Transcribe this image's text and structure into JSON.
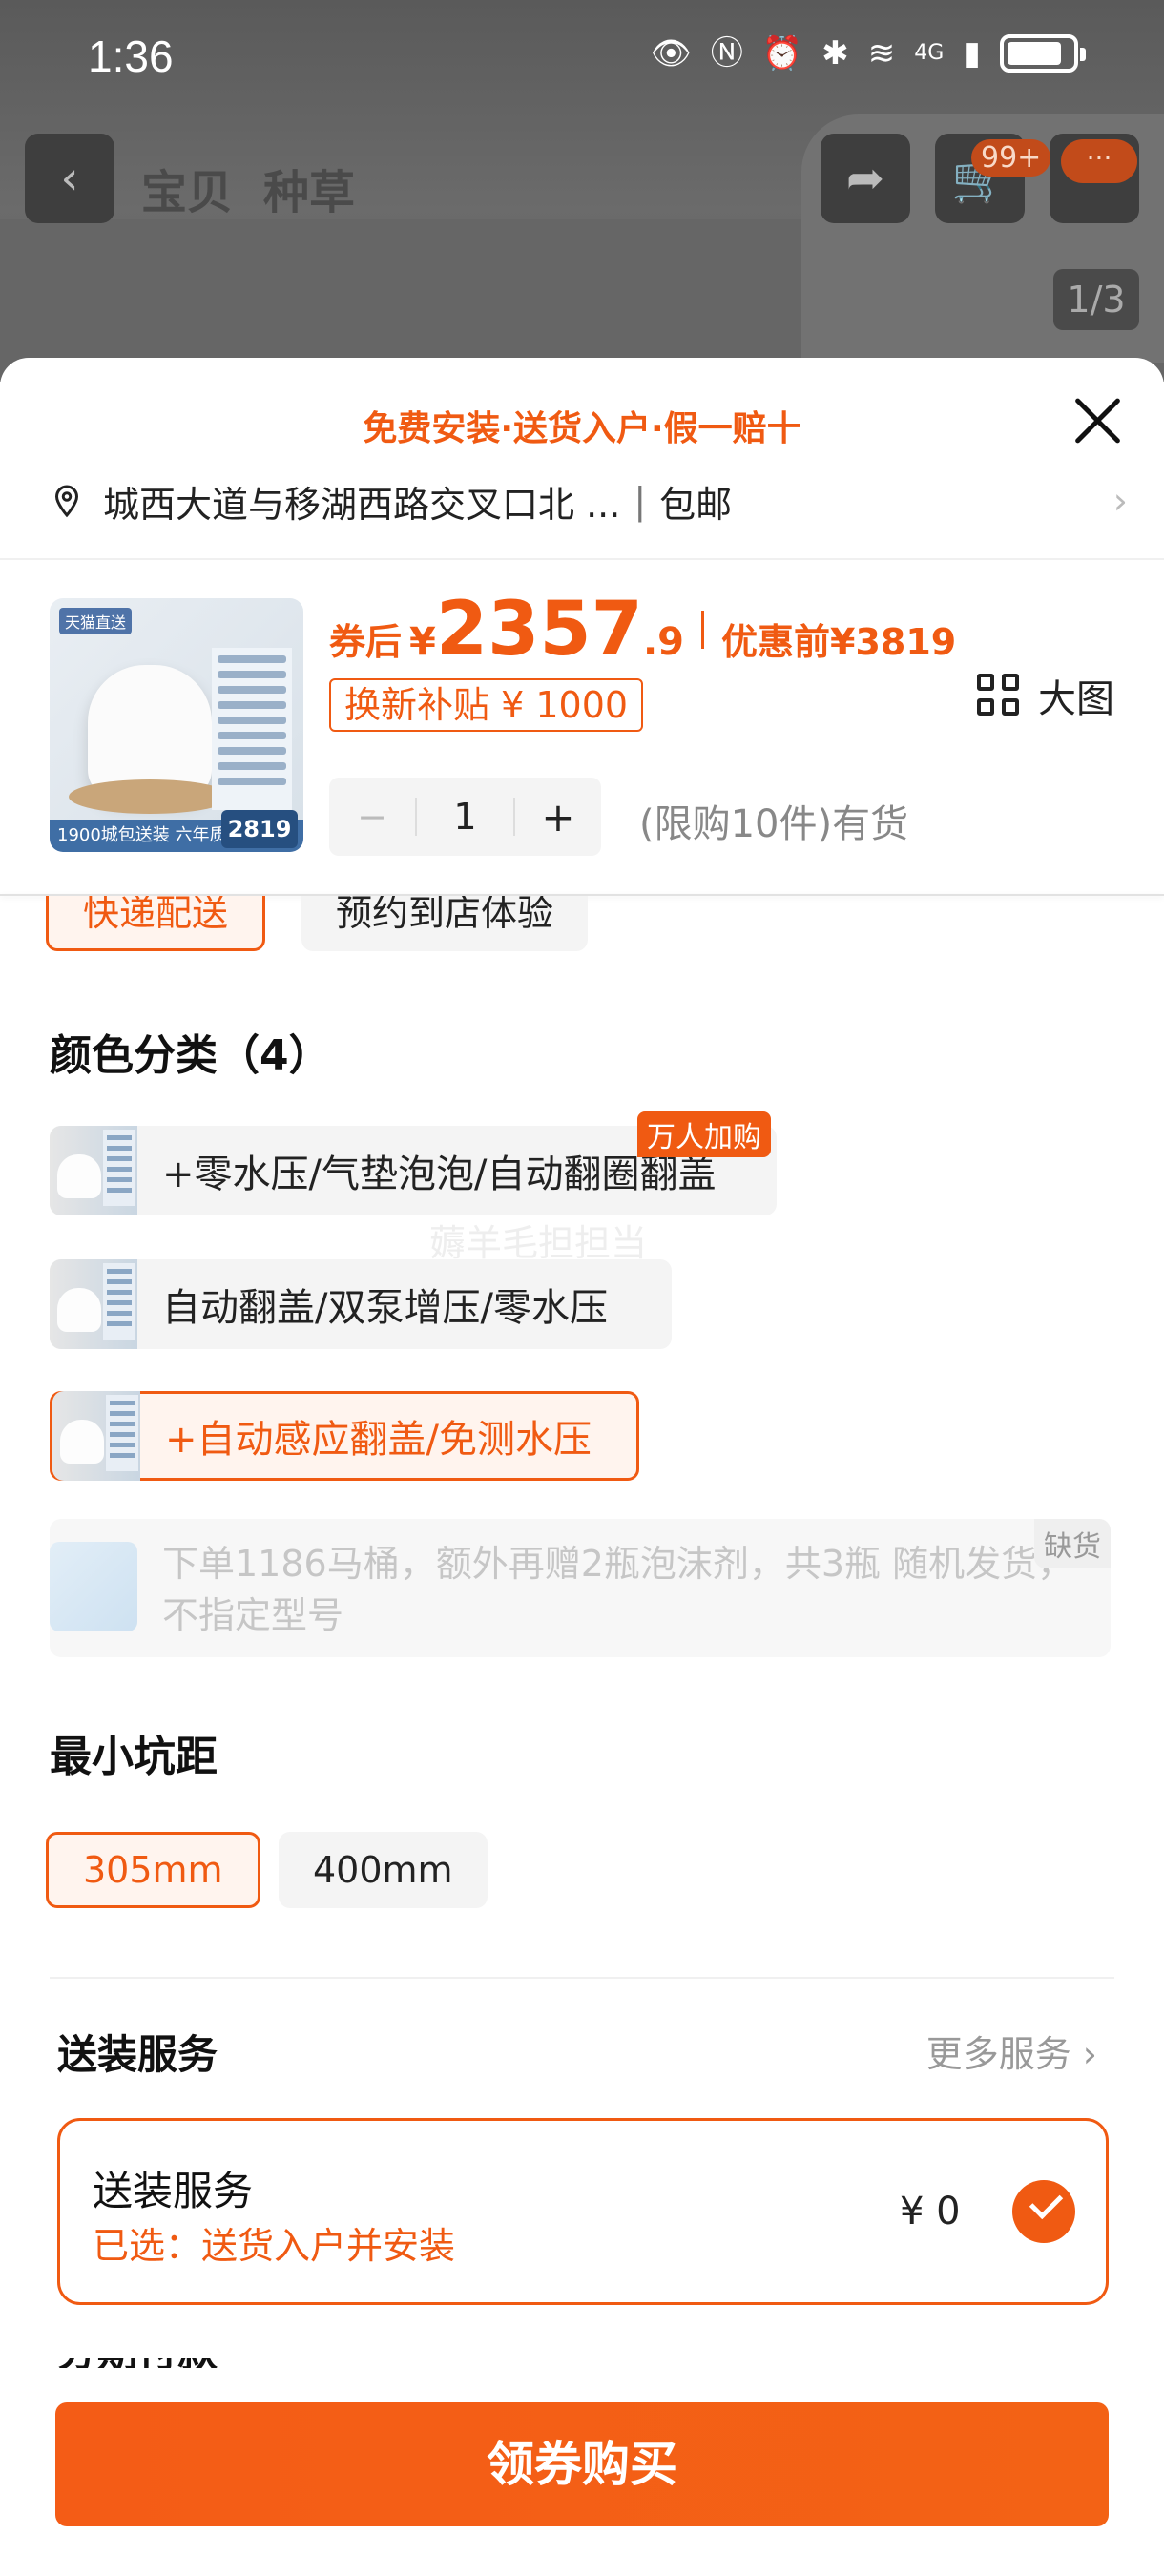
{
  "status": {
    "time": "1:36",
    "network": "4G",
    "icons": [
      "eye-icon",
      "nfc-icon",
      "alarm-icon",
      "bluetooth-icon",
      "wifi-icon",
      "signal-icon",
      "battery-icon"
    ]
  },
  "nav": {
    "tabs": [
      "宝贝",
      "种草"
    ],
    "cart_badge": "99+",
    "more_badge": "···",
    "pager": "1/3"
  },
  "sheet": {
    "banner": "免费安装·送货入户·假一赔十",
    "address": "城西大道与移湖西路交叉口北 ...",
    "shipping": "包邮"
  },
  "product": {
    "thumb": {
      "tag": "天猫直送",
      "footer": "1900城包送装  六年质保",
      "price": "2819"
    },
    "price_label": "券后",
    "currency": "¥",
    "price_int": "2357",
    "price_dec": ".9",
    "orig_label": "优惠前",
    "orig_price": "¥3819",
    "subsidy": "换新补贴 ¥ 1000",
    "quantity": "1",
    "minus": "−",
    "plus": "+",
    "stock": "(限购10件)有货"
  },
  "delivery": {
    "options": [
      "快递配送",
      "预约到店体验"
    ],
    "selected": "快递配送"
  },
  "color": {
    "title": "颜色分类（4）",
    "big_image": "大图",
    "hot_tag": "万人加购",
    "options": [
      "+零水压/气垫泡泡/自动翻圈翻盖",
      "自动翻盖/双泵增压/零水压",
      "+自动感应翻盖/免测水压"
    ],
    "selected_index": 2,
    "watermark": "薅羊毛担担当",
    "oos_text": "下单1186马桶，额外再赠2瓶泡沫剂，共3瓶 随机发货，不指定型号",
    "oos_tag": "缺货"
  },
  "size": {
    "title": "最小坑距",
    "options": [
      "305mm",
      "400mm"
    ],
    "selected": "305mm"
  },
  "service": {
    "title": "送装服务",
    "more": "更多服务",
    "card_name": "送装服务",
    "card_chosen": "已选：送货入户并安装",
    "card_price": "¥ 0"
  },
  "partial_title": "分期付款",
  "buy_button": "领券购买",
  "colors": {
    "accent": "#f05a12",
    "selected_bg": "#fff4ee",
    "chip_bg": "#f4f4f4"
  }
}
